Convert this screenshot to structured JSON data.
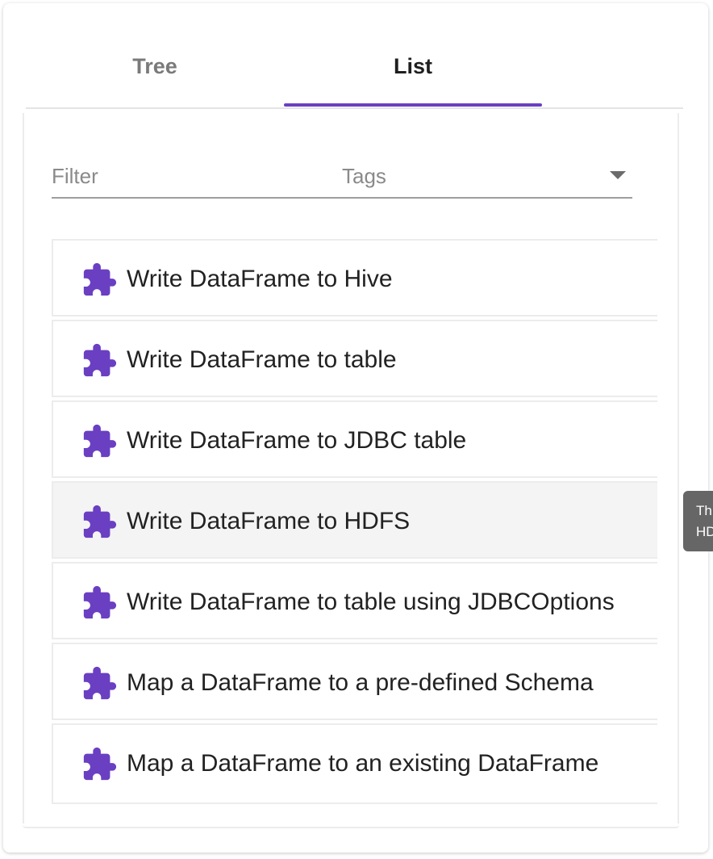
{
  "tabs": [
    {
      "label": "Tree",
      "active": false
    },
    {
      "label": "List",
      "active": true
    }
  ],
  "filter": {
    "placeholder": "Filter",
    "value": ""
  },
  "tags": {
    "label": "Tags"
  },
  "items": [
    {
      "label": "Write DataFrame to Hive",
      "icon": "puzzle-piece-icon"
    },
    {
      "label": "Write DataFrame to table",
      "icon": "puzzle-piece-icon"
    },
    {
      "label": "Write DataFrame to JDBC table",
      "icon": "puzzle-piece-icon"
    },
    {
      "label": "Write DataFrame to HDFS",
      "icon": "puzzle-piece-icon",
      "hovered": true
    },
    {
      "label": "Write DataFrame to table using JDBCOptions",
      "icon": "puzzle-piece-icon"
    },
    {
      "label": "Map a DataFrame to a pre-defined Schema",
      "icon": "puzzle-piece-icon"
    },
    {
      "label": "Map a DataFrame to an existing DataFrame",
      "icon": "puzzle-piece-icon"
    }
  ],
  "tooltip": {
    "line1": "Th",
    "line2": "HD"
  },
  "colors": {
    "accent": "#6a3fc2",
    "icon": "#6a3fc2",
    "tooltip_bg": "#666666"
  }
}
